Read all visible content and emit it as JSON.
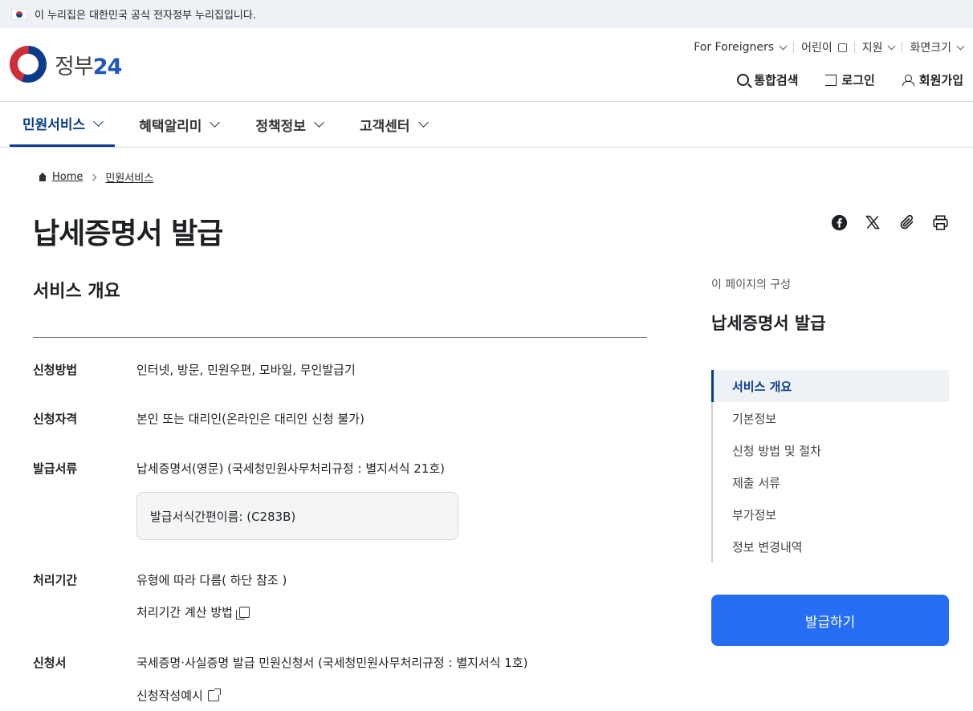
{
  "gov_banner": {
    "text": "이 누리집은 대한민국 공식 전자정부 누리집입니다."
  },
  "logo": {
    "text_main": "정부",
    "text_num": "24"
  },
  "utility_nav": [
    {
      "label": "For Foreigners",
      "icon": "chevron-down-icon"
    },
    {
      "label": "어린이",
      "icon": "external-link-icon"
    },
    {
      "label": "지원",
      "icon": "chevron-down-icon"
    },
    {
      "label": "화면크기",
      "icon": "chevron-down-icon"
    }
  ],
  "user_nav": {
    "search": "통합검색",
    "login": "로그인",
    "signup": "회원가입"
  },
  "main_nav": [
    {
      "label": "민원서비스",
      "active": true
    },
    {
      "label": "혜택알리미",
      "active": false
    },
    {
      "label": "정책정보",
      "active": false
    },
    {
      "label": "고객센터",
      "active": false
    }
  ],
  "breadcrumb": {
    "home": "Home",
    "current": "민원서비스"
  },
  "page_title": "납세증명서 발급",
  "share_icons": [
    "facebook-icon",
    "x-icon",
    "paperclip-icon",
    "print-icon"
  ],
  "section_title": "서비스 개요",
  "details": {
    "method": {
      "label": "신청방법",
      "value": "인터넷, 방문, 민원우편, 모바일, 무인발급기"
    },
    "eligibility": {
      "label": "신청자격",
      "value": "본인 또는 대리인(온라인은 대리인 신청 불가)"
    },
    "document": {
      "label": "발급서류",
      "value": "납세증명서(영문) (국세청민원사무처리규정 : 별지서식 21호)",
      "box": "발급서식간편이름: (C283B)"
    },
    "period": {
      "label": "처리기간",
      "value": "유형에 따라 다름( 하단 참조 )",
      "link": "처리기간 계산 방법"
    },
    "form": {
      "label": "신청서",
      "value": "국세증명·사실증명 발급 민원신청서 (국세청민원사무처리규정 : 별지서식 1호)",
      "link": "신청작성예시"
    }
  },
  "toc": {
    "caption": "이 페이지의 구성",
    "title": "납세증명서 발급",
    "items": [
      "서비스 개요",
      "기본정보",
      "신청 방법 및 절차",
      "제출 서류",
      "부가정보",
      "정보 변경내역"
    ]
  },
  "issue_button": "발급하기",
  "colors": {
    "accent": "#0b3c8c",
    "button": "#256ef4",
    "banner_bg": "#eef2f7"
  }
}
